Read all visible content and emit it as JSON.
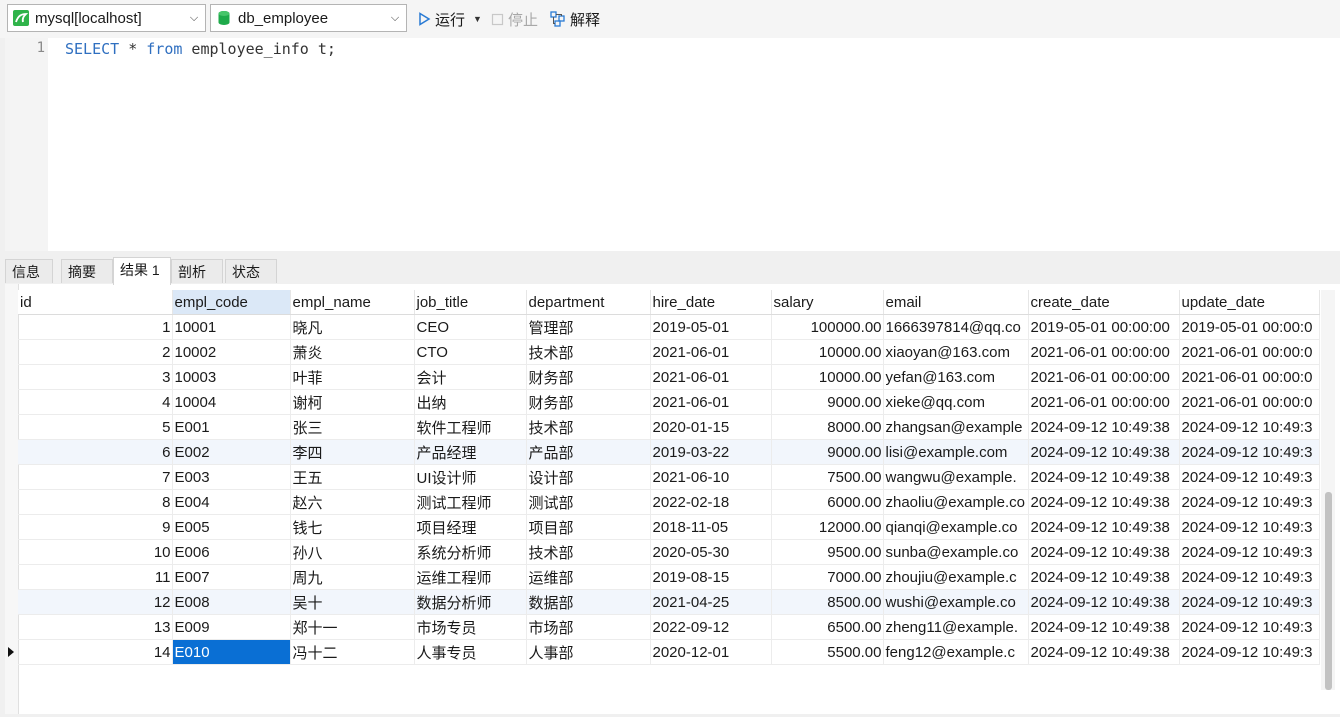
{
  "toolbar": {
    "connection": "mysql[localhost]",
    "database": "db_employee",
    "run_label": "运行",
    "stop_label": "停止",
    "explain_label": "解释",
    "icons": {
      "connection": "mysql-connection-icon",
      "database": "database-icon",
      "run": "play-icon",
      "stop": "stop-icon",
      "explain": "explain-icon"
    }
  },
  "editor": {
    "line_number": "1",
    "tokens": {
      "select": "SELECT",
      "star": " * ",
      "from": "from",
      "rest": " employee_info t;"
    }
  },
  "tabs": [
    "信息",
    "摘要",
    "结果 1",
    "剖析",
    "状态"
  ],
  "active_tab": "结果 1",
  "grid": {
    "columns": [
      "id",
      "empl_code",
      "empl_name",
      "job_title",
      "department",
      "hire_date",
      "salary",
      "email",
      "create_date",
      "update_date"
    ],
    "selected_column": "empl_code",
    "rows": [
      [
        "1",
        "10001",
        "晓凡",
        "CEO",
        "管理部",
        "2019-05-01",
        "100000.00",
        "1666397814@qq.co",
        "2019-05-01 00:00:00",
        "2019-05-01 00:00:0"
      ],
      [
        "2",
        "10002",
        "萧炎",
        "CTO",
        "技术部",
        "2021-06-01",
        "10000.00",
        "xiaoyan@163.com",
        "2021-06-01 00:00:00",
        "2021-06-01 00:00:0"
      ],
      [
        "3",
        "10003",
        "叶菲",
        "会计",
        "财务部",
        "2021-06-01",
        "10000.00",
        "yefan@163.com",
        "2021-06-01 00:00:00",
        "2021-06-01 00:00:0"
      ],
      [
        "4",
        "10004",
        "谢柯",
        "出纳",
        "财务部",
        "2021-06-01",
        "9000.00",
        "xieke@qq.com",
        "2021-06-01 00:00:00",
        "2021-06-01 00:00:0"
      ],
      [
        "5",
        "E001",
        "张三",
        "软件工程师",
        "技术部",
        "2020-01-15",
        "8000.00",
        "zhangsan@example",
        "2024-09-12 10:49:38",
        "2024-09-12 10:49:3"
      ],
      [
        "6",
        "E002",
        "李四",
        "产品经理",
        "产品部",
        "2019-03-22",
        "9000.00",
        "lisi@example.com",
        "2024-09-12 10:49:38",
        "2024-09-12 10:49:3"
      ],
      [
        "7",
        "E003",
        "王五",
        "UI设计师",
        "设计部",
        "2021-06-10",
        "7500.00",
        "wangwu@example.",
        "2024-09-12 10:49:38",
        "2024-09-12 10:49:3"
      ],
      [
        "8",
        "E004",
        "赵六",
        "测试工程师",
        "测试部",
        "2022-02-18",
        "6000.00",
        "zhaoliu@example.co",
        "2024-09-12 10:49:38",
        "2024-09-12 10:49:3"
      ],
      [
        "9",
        "E005",
        "钱七",
        "项目经理",
        "项目部",
        "2018-11-05",
        "12000.00",
        "qianqi@example.co",
        "2024-09-12 10:49:38",
        "2024-09-12 10:49:3"
      ],
      [
        "10",
        "E006",
        "孙八",
        "系统分析师",
        "技术部",
        "2020-05-30",
        "9500.00",
        "sunba@example.co",
        "2024-09-12 10:49:38",
        "2024-09-12 10:49:3"
      ],
      [
        "11",
        "E007",
        "周九",
        "运维工程师",
        "运维部",
        "2019-08-15",
        "7000.00",
        "zhoujiu@example.c",
        "2024-09-12 10:49:38",
        "2024-09-12 10:49:3"
      ],
      [
        "12",
        "E008",
        "吴十",
        "数据分析师",
        "数据部",
        "2021-04-25",
        "8500.00",
        "wushi@example.co",
        "2024-09-12 10:49:38",
        "2024-09-12 10:49:3"
      ],
      [
        "13",
        "E009",
        "郑十一",
        "市场专员",
        "市场部",
        "2022-09-12",
        "6500.00",
        "zheng11@example.",
        "2024-09-12 10:49:38",
        "2024-09-12 10:49:3"
      ],
      [
        "14",
        "E010",
        "冯十二",
        "人事专员",
        "人事部",
        "2020-12-01",
        "5500.00",
        "feng12@example.c",
        "2024-09-12 10:49:38",
        "2024-09-12 10:49:3"
      ]
    ],
    "current_row": 14,
    "selected_cell": {
      "row": 14,
      "column": "empl_code"
    }
  },
  "colors": {
    "keyword": "#2f6fc0",
    "selection": "#0a6fd4",
    "alt_row": "#f2f6fc",
    "selected_header": "#dbe8f7"
  }
}
